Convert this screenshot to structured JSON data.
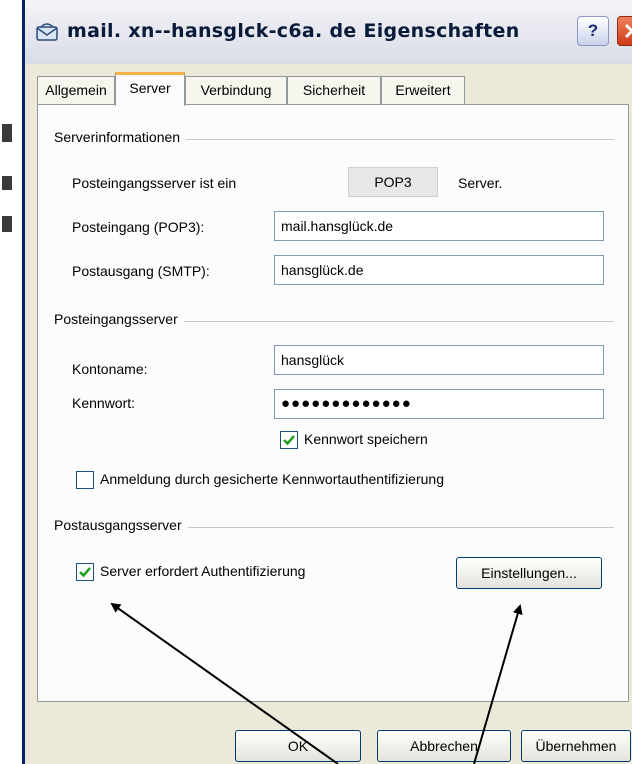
{
  "window": {
    "title": "mail. xn--hansglck-c6a. de Eigenschaften",
    "help_label": "?"
  },
  "tabs": [
    {
      "label": "Allgemein"
    },
    {
      "label": "Server"
    },
    {
      "label": "Verbindung"
    },
    {
      "label": "Sicherheit"
    },
    {
      "label": "Erweitert"
    }
  ],
  "server_info": {
    "group_title": "Serverinformationen",
    "incoming_type_prefix": "Posteingangsserver ist ein",
    "incoming_type_value": "POP3",
    "incoming_type_suffix": "Server.",
    "incoming_label": "Posteingang (POP3):",
    "incoming_value": "mail.hansglück.de",
    "outgoing_label": "Postausgang (SMTP):",
    "outgoing_value": "hansglück.de"
  },
  "incoming_server": {
    "group_title": "Posteingangsserver",
    "account_label": "Kontoname:",
    "account_value": "hansglück",
    "password_label": "Kennwort:",
    "password_value": "●●●●●●●●●●●●●",
    "save_password_label": "Kennwort speichern",
    "save_password_checked": true,
    "spa_label": "Anmeldung durch gesicherte Kennwortauthentifizierung",
    "spa_checked": false
  },
  "outgoing_server": {
    "group_title": "Postausgangsserver",
    "auth_label": "Server erfordert Authentifizierung",
    "auth_checked": true,
    "settings_button": "Einstellungen..."
  },
  "footer": {
    "ok_button": "OK",
    "cancel_button": "Abbrechen",
    "apply_button": "Übernehmen"
  },
  "colors": {
    "accent_blue": "#0a246a",
    "check_green": "#21a121",
    "tab_highlight": "#f6b04c"
  }
}
